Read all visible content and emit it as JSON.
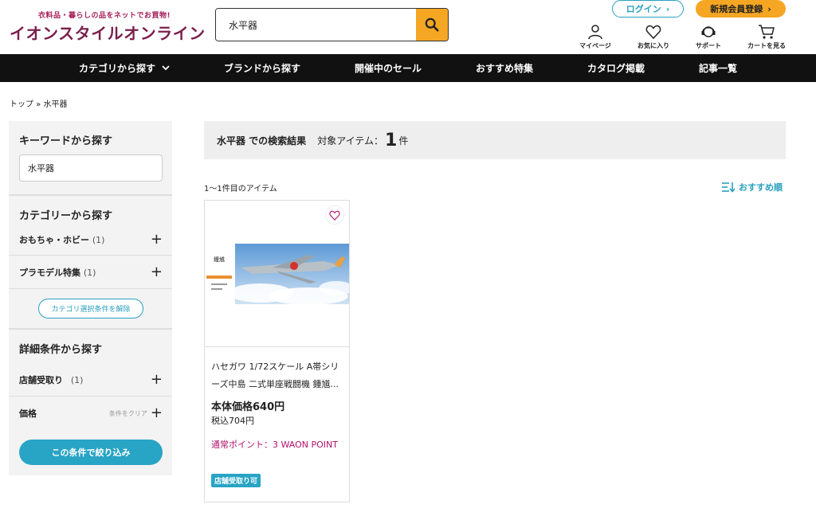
{
  "header": {
    "logo_tagline": "衣料品・暮らしの品をネットでお買物!",
    "logo_text": "イオンスタイルオンライン",
    "search_value": "水平器",
    "login_label": "ログイン",
    "register_label": "新規会員登録",
    "icons": [
      {
        "label": "マイページ",
        "icon": "person-icon"
      },
      {
        "label": "お気に入り",
        "icon": "heart-icon"
      },
      {
        "label": "サポート",
        "icon": "headset-icon"
      },
      {
        "label": "カートを見る",
        "icon": "cart-icon"
      }
    ],
    "brand_color": "#7a1e4c",
    "accent_color": "#f5a623"
  },
  "nav": {
    "items": [
      "カテゴリから探す",
      "ブランドから探す",
      "開催中のセール",
      "おすすめ特集",
      "カタログ掲載",
      "記事一覧"
    ]
  },
  "breadcrumb": "トップ » 水平器",
  "sidebar": {
    "keyword_heading": "キーワードから探す",
    "keyword_value": "水平器",
    "category_heading": "カテゴリーから探す",
    "categories": [
      {
        "label": "おもちゃ・ホビー",
        "count": "(1)"
      },
      {
        "label": "プラモデル特集",
        "count": "(1)"
      }
    ],
    "clear_category": "カテゴリ選択条件を解除",
    "detail_heading": "詳細条件から探す",
    "store_pickup": {
      "label": "店舗受取り",
      "count": "(1)"
    },
    "price_label": "価格",
    "price_clear": "条件をクリア",
    "apply_label": "この条件で絞り込み"
  },
  "results": {
    "query": "水平器 での検索結果",
    "target_label": "対象アイテム：",
    "count": "1",
    "count_unit": "件",
    "range": "1〜1件目のアイテム",
    "sort_label": "おすすめ順"
  },
  "product": {
    "name": "ハセガワ 1/72スケール A帯シリーズ中島 二式単座戦闘機 鍾馗...",
    "price": "本体価格640円",
    "tax_in": "税込704円",
    "points": "通常ポイント：3 WAON POINT",
    "badge": "店舗受取り可",
    "box_title": "鍾馗"
  }
}
